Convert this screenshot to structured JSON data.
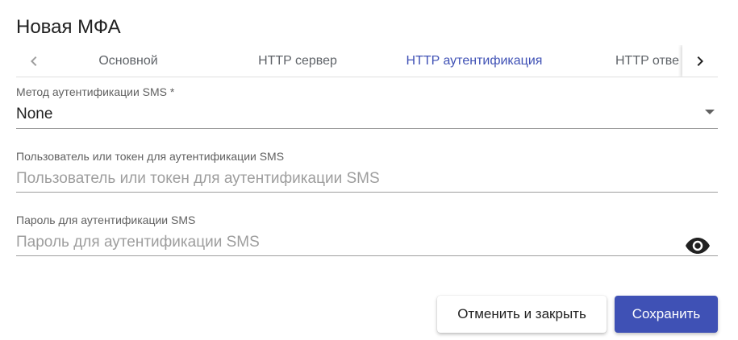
{
  "dialog": {
    "title": "Новая МФА"
  },
  "tabs": [
    {
      "label": "Основной"
    },
    {
      "label": "HTTP сервер"
    },
    {
      "label": "HTTP аутентификация",
      "active": true
    },
    {
      "label": "HTTP отве"
    }
  ],
  "fields": {
    "method": {
      "label": "Метод аутентификации SMS *",
      "value": "None"
    },
    "user": {
      "label": "Пользователь или токен для аутентификации SMS",
      "placeholder": "Пользователь или токен для аутентификации SMS"
    },
    "password": {
      "label": "Пароль для аутентификации SMS",
      "placeholder": "Пароль для аутентификации SMS"
    }
  },
  "buttons": {
    "cancel": "Отменить и закрыть",
    "save": "Сохранить"
  },
  "colors": {
    "accent": "#3f51b5"
  },
  "icons": {
    "tab_left": "chevron-left-icon",
    "tab_right": "chevron-right-icon",
    "dropdown": "arrow-drop-down-icon",
    "visibility": "eye-icon"
  }
}
